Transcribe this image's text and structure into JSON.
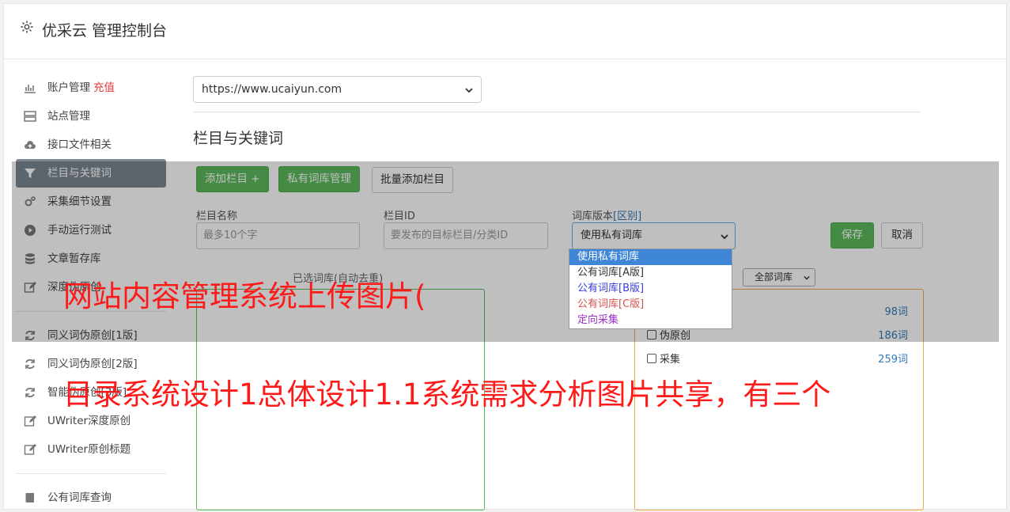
{
  "header": {
    "title": "优采云 管理控制台",
    "icon": "gear-icon"
  },
  "sidebar": {
    "items": [
      {
        "label": "账户管理",
        "accent": "充值",
        "icon": "bar-chart-icon"
      },
      {
        "label": "站点管理",
        "icon": "server-icon"
      },
      {
        "label": "接口文件相关",
        "icon": "cloud-upload-icon"
      },
      {
        "label": "栏目与关键词",
        "icon": "filter-icon",
        "active": true
      },
      {
        "label": "采集细节设置",
        "icon": "cogs-icon"
      },
      {
        "label": "手动运行测试",
        "icon": "play-circle-icon"
      },
      {
        "label": "文章暂存库",
        "icon": "database-icon"
      },
      {
        "label": "深度伪原创",
        "icon": "edit-icon"
      }
    ],
    "items2": [
      {
        "label": "同义词伪原创[1版]",
        "icon": "refresh-icon"
      },
      {
        "label": "同义词伪原创[2版]",
        "icon": "refresh-icon"
      },
      {
        "label": "智能伪原创[3版]",
        "icon": "refresh-icon"
      },
      {
        "label": "UWriter深度原创",
        "icon": "edit-icon"
      },
      {
        "label": "UWriter原创标题",
        "icon": "edit-icon"
      }
    ],
    "items3": [
      {
        "label": "公有词库查询",
        "icon": "book-icon"
      }
    ]
  },
  "main": {
    "site_select": "https://www.ucaiyun.com",
    "section_title": "栏目与关键词",
    "buttons": {
      "add_column": "添加栏目 +",
      "private_lib": "私有词库管理",
      "batch_add": "批量添加栏目"
    },
    "form": {
      "name_label": "栏目名称",
      "name_placeholder": "最多10个字",
      "id_label": "栏目ID",
      "id_placeholder": "要发布的目标栏目/分类ID",
      "version_label": "词库版本",
      "version_link": "[区别]",
      "version_value": "使用私有词库",
      "save": "保存",
      "cancel": "取消"
    },
    "version_options": [
      {
        "label": "使用私有词库",
        "color": "#ffffff"
      },
      {
        "label": "公有词库[A版]",
        "color": "#333333"
      },
      {
        "label": "公有词库[B版]",
        "color": "#3b3bd9"
      },
      {
        "label": "公有词库[C版]",
        "color": "#d9534f"
      },
      {
        "label": "定向采集",
        "color": "#9b30c9"
      }
    ],
    "selected_words_label": "已选词库(自动去重)",
    "lib_filter": "全部词库",
    "lib_rows": [
      {
        "label": "",
        "count": "98词"
      },
      {
        "label": "伪原创",
        "count": "186词"
      },
      {
        "label": "采集",
        "count": "259词"
      }
    ]
  },
  "watermark": {
    "line1": "网站内容管理系统上传图片(",
    "line2": "目录系统设计1总体设计1.1系统需求分析图片共享，有三个"
  },
  "colors": {
    "green": "#5cb85c",
    "active_nav": "#7b8691",
    "link": "#337ab7",
    "watermark": "#ff1a1a"
  }
}
